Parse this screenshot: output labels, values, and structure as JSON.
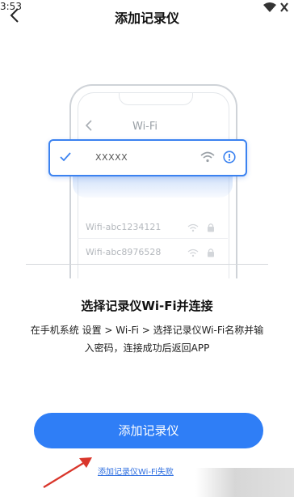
{
  "status_bar": {
    "time": "3:53"
  },
  "nav": {
    "title": "添加记录仪",
    "back_icon": "chevron-left-icon"
  },
  "illustration": {
    "screen_title": "Wi-Fi",
    "selected_network": "XXXXX",
    "networks": [
      "Wifi-abc1234121",
      "Wifi-abc8976528"
    ]
  },
  "instructions": {
    "title": "选择记录仪Wi-Fi并连接",
    "line1": "在手机系统 设置 > Wi-Fi > 选择记录仪Wi-Fi名称并输",
    "line2": "入密码，连接成功后返回APP"
  },
  "primary_button": {
    "label": "添加记录仪"
  },
  "help_link": {
    "label": "添加记录仪Wi-Fi失败"
  },
  "colors": {
    "accent": "#2f7ef6",
    "link": "#2f6fe0",
    "annotation_arrow": "#d9362b"
  }
}
